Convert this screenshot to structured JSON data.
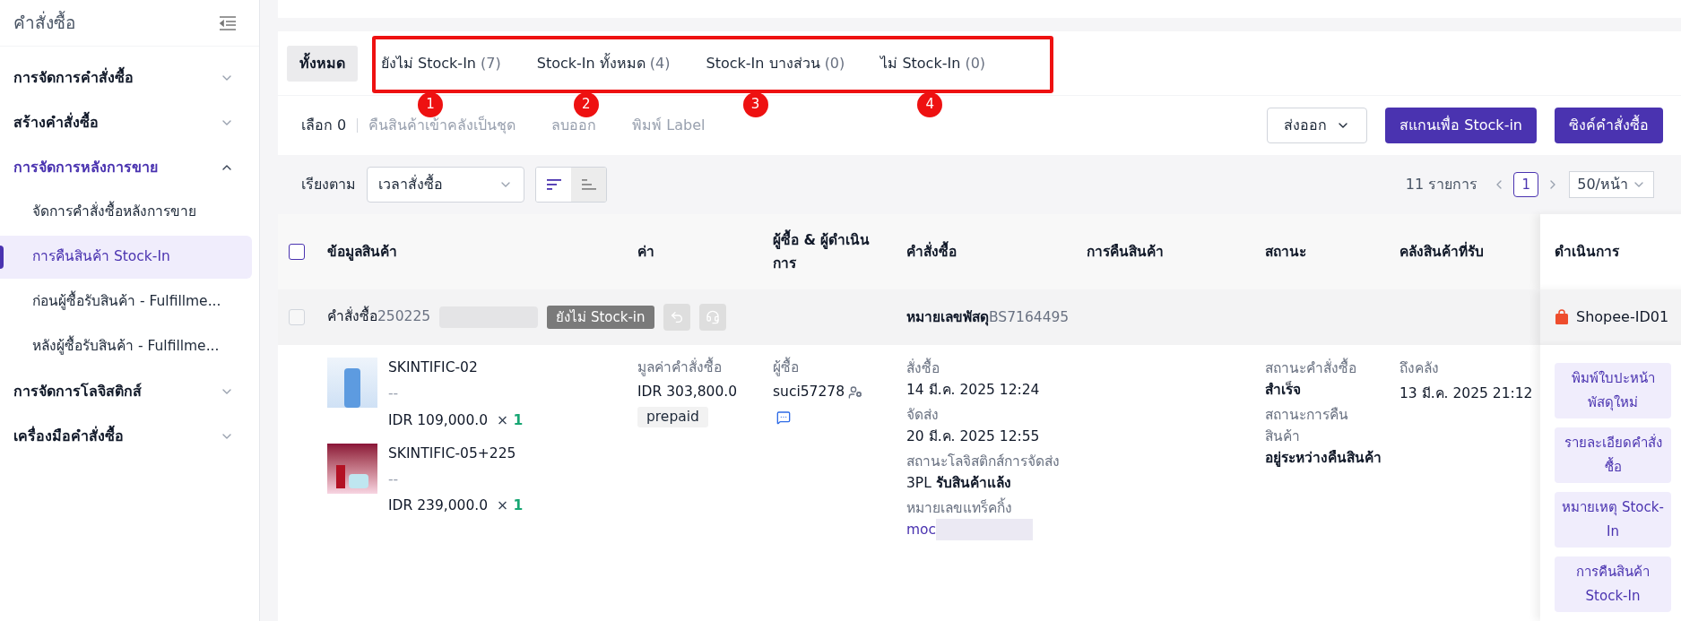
{
  "sidebar": {
    "title": "คำสั่งซื้อ",
    "items": [
      {
        "label": "การจัดการคำสั่งซื้อ",
        "expanded": false
      },
      {
        "label": "สร้างคำสั่งซื้อ",
        "expanded": false
      },
      {
        "label": "การจัดการหลังการขาย",
        "expanded": true,
        "children": [
          {
            "label": "จัดการคำสั่งซื้อหลังการขาย",
            "selected": false
          },
          {
            "label": "การคืนสินค้า Stock-In",
            "selected": true
          },
          {
            "label": "ก่อนผู้ซื้อรับสินค้า - Fulfillme...",
            "selected": false
          },
          {
            "label": "หลังผู้ซื้อรับสินค้า - Fulfillme...",
            "selected": false
          }
        ]
      },
      {
        "label": "การจัดการโลจิสติกส์",
        "expanded": false
      },
      {
        "label": "เครื่องมือคำสั่งซื้อ",
        "expanded": false
      }
    ]
  },
  "tabs": [
    {
      "label": "ทั้งหมด",
      "selected": true
    },
    {
      "label": "ยังไม่ Stock-In",
      "count": "(7)",
      "selected": false,
      "marker": "1"
    },
    {
      "label": "Stock-In ทั้งหมด",
      "count": "(4)",
      "selected": false,
      "marker": "2"
    },
    {
      "label": "Stock-In บางส่วน",
      "count": "(0)",
      "selected": false,
      "marker": "3"
    },
    {
      "label": "ไม่ Stock-In",
      "count": "(0)",
      "selected": false,
      "marker": "4"
    }
  ],
  "bulk_bar": {
    "selected_label": "เลือก 0",
    "actions": [
      {
        "label": "คืนสินค้าเข้าคลังเป็นชุด",
        "disabled": true
      },
      {
        "label": "ลบออก",
        "disabled": true
      },
      {
        "label": "พิมพ์ Label",
        "disabled": true
      }
    ]
  },
  "buttons": {
    "export": "ส่งออก",
    "scan": "สแกนเพื่อ Stock-in",
    "sync": "ซิงค์คำสั่งซื้อ"
  },
  "sort": {
    "label": "เรียงตาม",
    "value": "เวลาสั่งซื้อ",
    "buttons": [
      {
        "kind": "desc",
        "selected": true
      },
      {
        "kind": "asc",
        "selected": false
      }
    ]
  },
  "pagination": {
    "total": "11 รายการ",
    "page": "1",
    "page_size": "50/หน้า"
  },
  "table": {
    "columns": [
      "ข้อมูลสินค้า",
      "ค่า",
      "ผู้ซื้อ & ผู้ดำเนินการ",
      "คำสั่งซื้อ",
      "การคืนสินค้า",
      "สถานะ",
      "คลังสินค้าที่รับ",
      "ดำเนินการ"
    ],
    "select_all_checked": false,
    "orders": [
      {
        "checked": false,
        "order_label": "คำสั่งซื้อ",
        "order_no": "250225",
        "status_badge": "ยังไม่ Stock-in",
        "tracking_label": "หมายเลขพัสดุ",
        "tracking_no": "BS7164495",
        "store": "Shopee-ID01",
        "items": [
          {
            "name": "SKINTIFIC-02",
            "variant": "--",
            "price": "IDR 109,000.0",
            "times": "×",
            "qty": "1",
            "kind": "bottle"
          },
          {
            "name": "SKINTIFIC-05+225",
            "variant": "--",
            "price": "IDR 239,000.0",
            "times": "×",
            "qty": "1",
            "kind": "set"
          }
        ],
        "value": {
          "label": "มูลค่าคำสั่งซื้อ",
          "amount": "IDR 303,800.0",
          "payment": "prepaid"
        },
        "buyer": {
          "label": "ผู้ซื้อ",
          "name": "suci57278"
        },
        "order_info": [
          {
            "label": "สั่งซื้อ",
            "value": "14 มี.ค. 2025 12:24"
          },
          {
            "label": "จัดส่ง",
            "value": "20 มี.ค. 2025 12:55"
          },
          {
            "label": "สถานะโลจิสติกส์การจัดส่ง",
            "value": "3PL **รับสินค้าแล้ง**"
          },
          {
            "label": "หมายเลขแทร็คกิ้ง",
            "value": "moc",
            "kind": "link"
          }
        ],
        "status": [
          {
            "label": "สถานะคำสั่งซื้อ",
            "value": "สำเร็จ"
          },
          {
            "label": "สถานะการคืนสินค้า",
            "value": "อยู่ระหว่างคืนสินค้า"
          }
        ],
        "warehouse": {
          "label": "ถึงคลัง",
          "value": "13 มี.ค. 2025 21:12"
        },
        "actions": [
          "พิมพ์ใบปะหน้าพัสดุใหม่",
          "รายละเอียดคำสั่งซื้อ",
          "หมายเหตุ Stock-In",
          "การคืนสินค้า Stock-In"
        ]
      }
    ]
  }
}
